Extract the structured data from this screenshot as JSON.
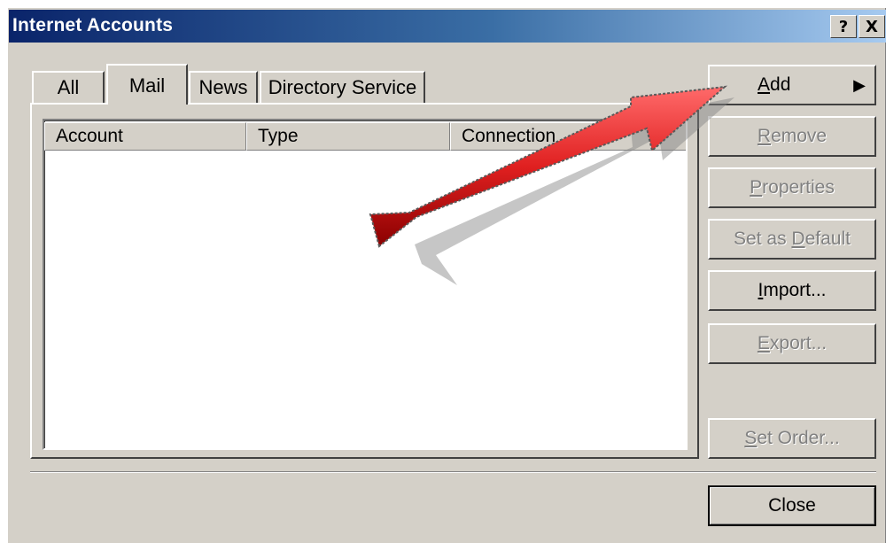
{
  "window": {
    "title": "Internet Accounts",
    "help_glyph": "?",
    "close_glyph": "X"
  },
  "tabs": [
    {
      "label": "All"
    },
    {
      "label": "Mail",
      "selected": true
    },
    {
      "label": "News"
    },
    {
      "label": "Directory Service"
    }
  ],
  "list": {
    "columns": [
      "Account",
      "Type",
      "Connection"
    ],
    "rows": []
  },
  "buttons": {
    "add": {
      "pre": "",
      "key": "A",
      "post": "dd",
      "arrow": "▶"
    },
    "remove": {
      "pre": "",
      "key": "R",
      "post": "emove"
    },
    "properties": {
      "pre": "",
      "key": "P",
      "post": "roperties"
    },
    "set_default": {
      "pre": "Set as ",
      "key": "D",
      "post": "efault"
    },
    "import": {
      "pre": "",
      "key": "I",
      "post": "mport..."
    },
    "export": {
      "pre": "",
      "key": "E",
      "post": "xport..."
    },
    "set_order": {
      "pre": "",
      "key": "S",
      "post": "et Order..."
    },
    "close": {
      "label": "Close"
    }
  },
  "annotation": {
    "color": "#e02020"
  }
}
